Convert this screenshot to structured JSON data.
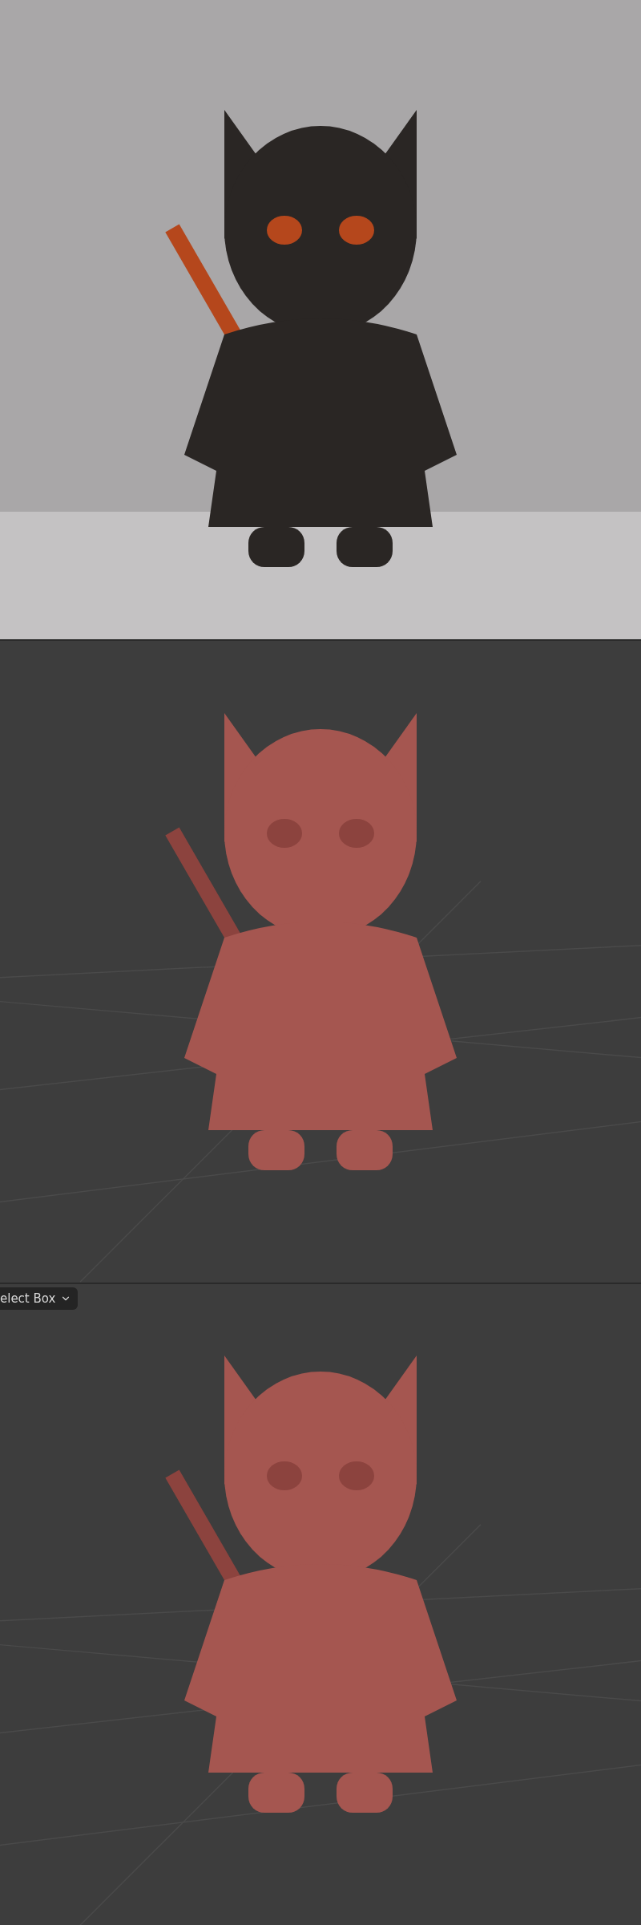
{
  "viewport_bottom": {
    "tool_dropdown": {
      "label": "elect Box"
    }
  }
}
